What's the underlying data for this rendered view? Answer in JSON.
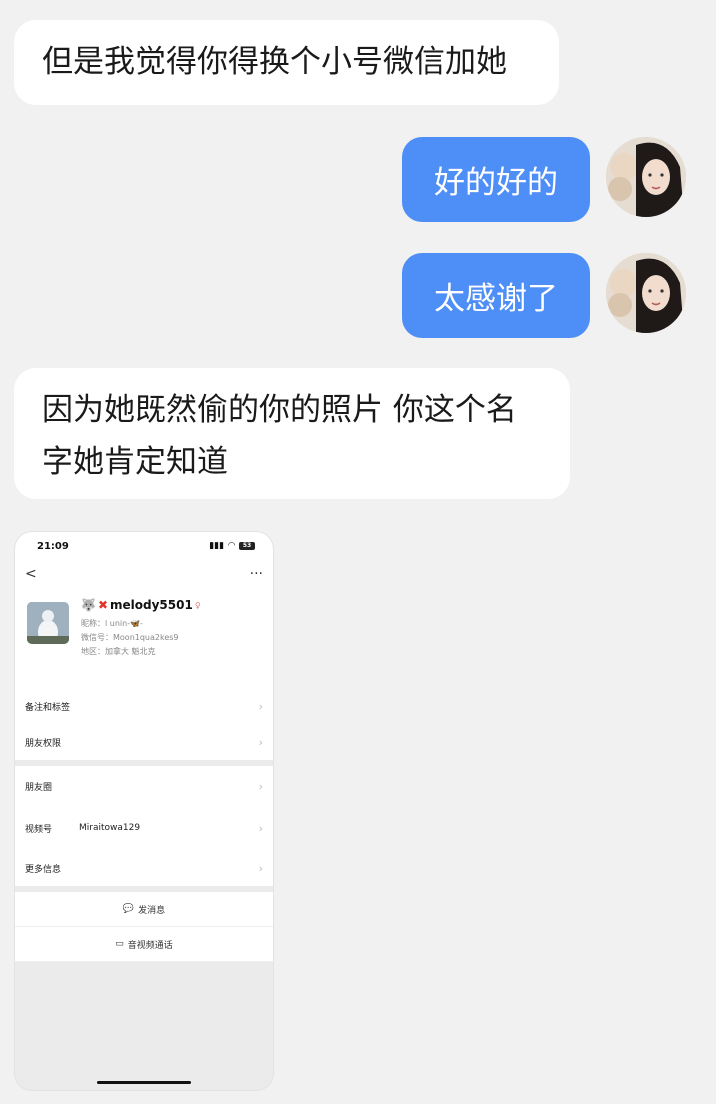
{
  "messages": [
    {
      "side": "left",
      "text": "但是我觉得你得换个小号微信加她"
    },
    {
      "side": "right",
      "text": "好的好的"
    },
    {
      "side": "right",
      "text": "太感谢了"
    },
    {
      "side": "left",
      "line1": "因为她既然偷的你的照片 你这个名",
      "line2": "字她肯定知道"
    }
  ],
  "avatar_icon": "user-avatar-photo",
  "colors": {
    "bubble_right": "#4e8ef7",
    "bubble_left": "#ffffff",
    "background": "#f1f1f1"
  },
  "screenshot": {
    "status_time": "21:09",
    "battery": "53",
    "back_glyph": "<",
    "more_glyph": "···",
    "profile": {
      "name": "melody5501",
      "nickname": "昵称：l unin-🦋-",
      "wechat_id": "微信号：Moon1qua2kes9",
      "region": "地区：加拿大 魁北克"
    },
    "rows": [
      {
        "label": "备注和标签",
        "value": ""
      },
      {
        "label": "朋友权限",
        "value": ""
      },
      {
        "label": "朋友圈",
        "value": ""
      },
      {
        "label": "视频号",
        "value": "Miraitowa129"
      },
      {
        "label": "更多信息",
        "value": ""
      }
    ],
    "actions": [
      {
        "icon": "chat-bubble-icon",
        "label": "发消息"
      },
      {
        "icon": "video-call-icon",
        "label": "音视频通话"
      }
    ]
  }
}
